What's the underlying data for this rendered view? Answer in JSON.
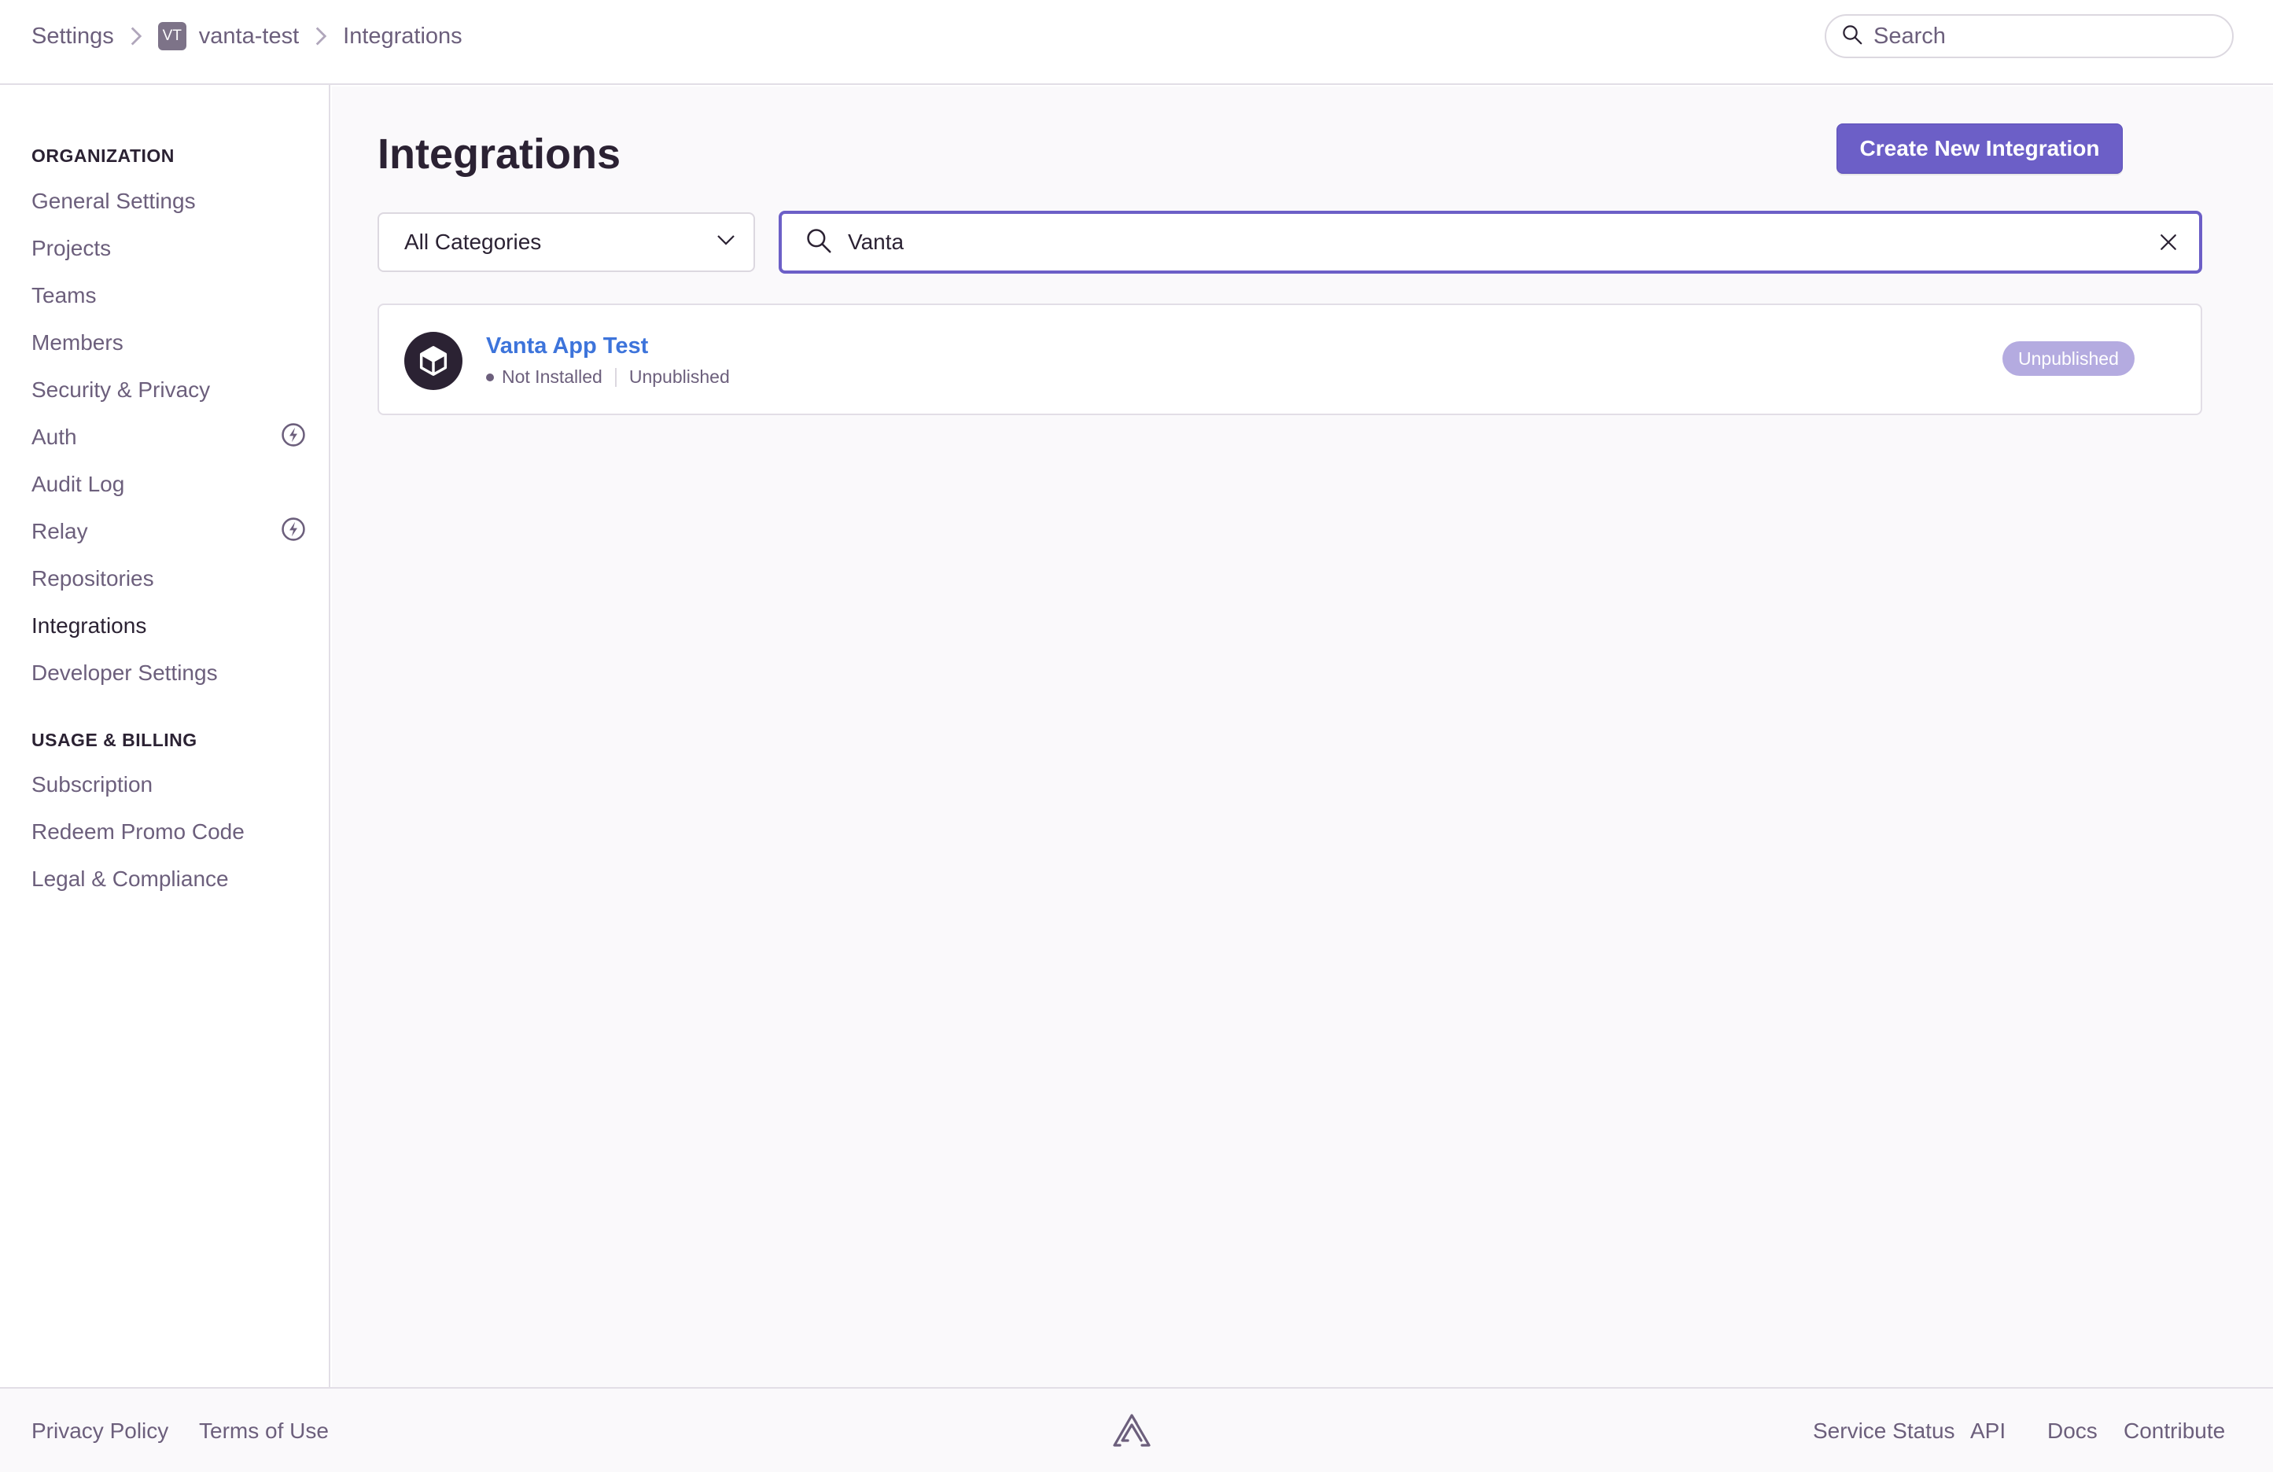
{
  "breadcrumb": {
    "settings": "Settings",
    "org_avatar": "VT",
    "org_name": "vanta-test",
    "current": "Integrations"
  },
  "top_search": {
    "placeholder": "Search"
  },
  "sidebar": {
    "organization_title": "ORGANIZATION",
    "org_items": [
      {
        "label": "General Settings"
      },
      {
        "label": "Projects"
      },
      {
        "label": "Teams"
      },
      {
        "label": "Members"
      },
      {
        "label": "Security & Privacy"
      },
      {
        "label": "Auth",
        "icon": "lightning-badge-icon"
      },
      {
        "label": "Audit Log"
      },
      {
        "label": "Relay",
        "icon": "lightning-badge-icon"
      },
      {
        "label": "Repositories"
      },
      {
        "label": "Integrations",
        "active": true
      },
      {
        "label": "Developer Settings"
      }
    ],
    "billing_title": "USAGE & BILLING",
    "billing_items": [
      {
        "label": "Subscription"
      },
      {
        "label": "Redeem Promo Code"
      },
      {
        "label": "Legal & Compliance"
      }
    ]
  },
  "main": {
    "title": "Integrations",
    "create_button": "Create New Integration",
    "category_select": "All Categories",
    "search_value": "Vanta",
    "integrations": [
      {
        "name": "Vanta App Test",
        "install_status": "Not Installed",
        "publish_status": "Unpublished",
        "badge": "Unpublished",
        "icon": "package-icon"
      }
    ]
  },
  "footer": {
    "privacy": "Privacy Policy",
    "terms": "Terms of Use",
    "service_status": "Service Status",
    "api": "API",
    "docs": "Docs",
    "contribute": "Contribute"
  },
  "colors": {
    "accent": "#6c5fc7",
    "link": "#3d74db",
    "text": "#2b2233",
    "muted": "#6c5f7c",
    "badge": "#b4abe0"
  }
}
